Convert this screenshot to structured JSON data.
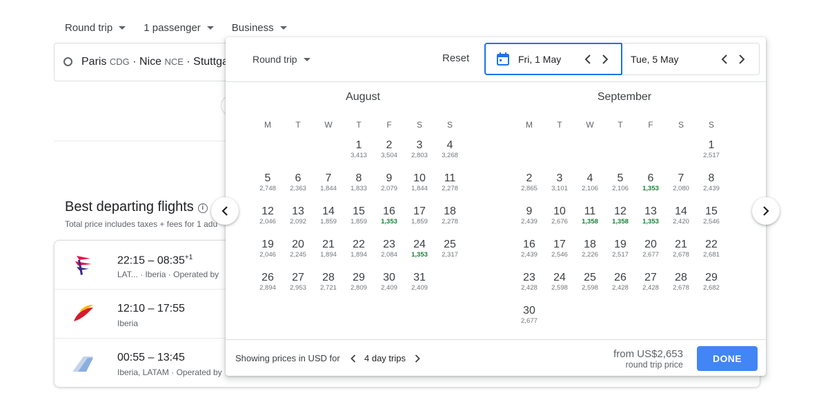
{
  "search": {
    "trip_type": "Round trip",
    "passengers": "1 passenger",
    "cabin": "Business",
    "origin": [
      {
        "city": "Paris",
        "code": "CDG",
        "sep": " · "
      },
      {
        "city": "Nice",
        "code": "NCE",
        "sep": " · "
      },
      {
        "city": "Stuttgar",
        "code": "",
        "sep": ""
      }
    ]
  },
  "results": {
    "title": "Best departing flights",
    "subtitle": "Total price includes taxes + fees for 1 adu",
    "flights": [
      {
        "times": "22:15 – 08:35",
        "plus": "+1",
        "airlines": "LAT... ·  Iberia  ·  Operated by"
      },
      {
        "times": "12:10 – 17:55",
        "plus": "",
        "airlines": "Iberia"
      },
      {
        "times": "00:55 – 13:45",
        "plus": "",
        "airlines": "Iberia, LATAM  ·  Operated by"
      }
    ]
  },
  "picker": {
    "trip_type": "Round trip",
    "reset": "Reset",
    "departure": "Fri, 1 May",
    "return": "Tue, 5 May",
    "weekdays": [
      "M",
      "T",
      "W",
      "T",
      "F",
      "S",
      "S"
    ],
    "months": [
      {
        "name": "August",
        "offset": 3,
        "days": [
          {
            "d": "1",
            "p": "3,413"
          },
          {
            "d": "2",
            "p": "3,504"
          },
          {
            "d": "3",
            "p": "2,803"
          },
          {
            "d": "4",
            "p": "3,268"
          },
          {
            "d": "5",
            "p": "2,748"
          },
          {
            "d": "6",
            "p": "2,363"
          },
          {
            "d": "7",
            "p": "1,844"
          },
          {
            "d": "8",
            "p": "1,833"
          },
          {
            "d": "9",
            "p": "2,079"
          },
          {
            "d": "10",
            "p": "1,844"
          },
          {
            "d": "11",
            "p": "2,278"
          },
          {
            "d": "12",
            "p": "2,046"
          },
          {
            "d": "13",
            "p": "2,092"
          },
          {
            "d": "14",
            "p": "1,859"
          },
          {
            "d": "15",
            "p": "1,859"
          },
          {
            "d": "16",
            "p": "1,353",
            "low": true
          },
          {
            "d": "17",
            "p": "1,859"
          },
          {
            "d": "18",
            "p": "2,278"
          },
          {
            "d": "19",
            "p": "2,046"
          },
          {
            "d": "20",
            "p": "2,245"
          },
          {
            "d": "21",
            "p": "1,894"
          },
          {
            "d": "22",
            "p": "1,894"
          },
          {
            "d": "23",
            "p": "2,084"
          },
          {
            "d": "24",
            "p": "1,353",
            "low": true
          },
          {
            "d": "25",
            "p": "2,317"
          },
          {
            "d": "26",
            "p": "2,894"
          },
          {
            "d": "27",
            "p": "2,953"
          },
          {
            "d": "28",
            "p": "2,721"
          },
          {
            "d": "29",
            "p": "2,809"
          },
          {
            "d": "30",
            "p": "2,409"
          },
          {
            "d": "31",
            "p": "2,409"
          }
        ]
      },
      {
        "name": "September",
        "offset": 6,
        "days": [
          {
            "d": "1",
            "p": "2,517"
          },
          {
            "d": "2",
            "p": "2,865"
          },
          {
            "d": "3",
            "p": "3,101"
          },
          {
            "d": "4",
            "p": "2,106"
          },
          {
            "d": "5",
            "p": "2,106"
          },
          {
            "d": "6",
            "p": "1,353",
            "low": true
          },
          {
            "d": "7",
            "p": "2,080"
          },
          {
            "d": "8",
            "p": "2,439"
          },
          {
            "d": "9",
            "p": "2,439"
          },
          {
            "d": "10",
            "p": "2,676"
          },
          {
            "d": "11",
            "p": "1,358",
            "low": true
          },
          {
            "d": "12",
            "p": "1,358",
            "low": true
          },
          {
            "d": "13",
            "p": "1,353",
            "low": true
          },
          {
            "d": "14",
            "p": "2,420"
          },
          {
            "d": "15",
            "p": "2,546"
          },
          {
            "d": "16",
            "p": "2,439"
          },
          {
            "d": "17",
            "p": "2,546"
          },
          {
            "d": "18",
            "p": "2,226"
          },
          {
            "d": "19",
            "p": "2,517"
          },
          {
            "d": "20",
            "p": "2,677"
          },
          {
            "d": "21",
            "p": "2,678"
          },
          {
            "d": "22",
            "p": "2,681"
          },
          {
            "d": "23",
            "p": "2,428"
          },
          {
            "d": "24",
            "p": "2,598"
          },
          {
            "d": "25",
            "p": "2,598"
          },
          {
            "d": "26",
            "p": "2,428"
          },
          {
            "d": "27",
            "p": "2,428"
          },
          {
            "d": "28",
            "p": "2,678"
          },
          {
            "d": "29",
            "p": "2,682"
          },
          {
            "d": "30",
            "p": "2,677"
          }
        ]
      }
    ],
    "footer": {
      "showing": "Showing prices in USD for",
      "trip_length": "4 day trips",
      "from_price": "from US$2,653",
      "price_type": "round trip price",
      "done": "DONE"
    }
  },
  "colors": {
    "accent": "#1a73e8",
    "done_button": "#4285f4",
    "low_price": "#188038"
  }
}
